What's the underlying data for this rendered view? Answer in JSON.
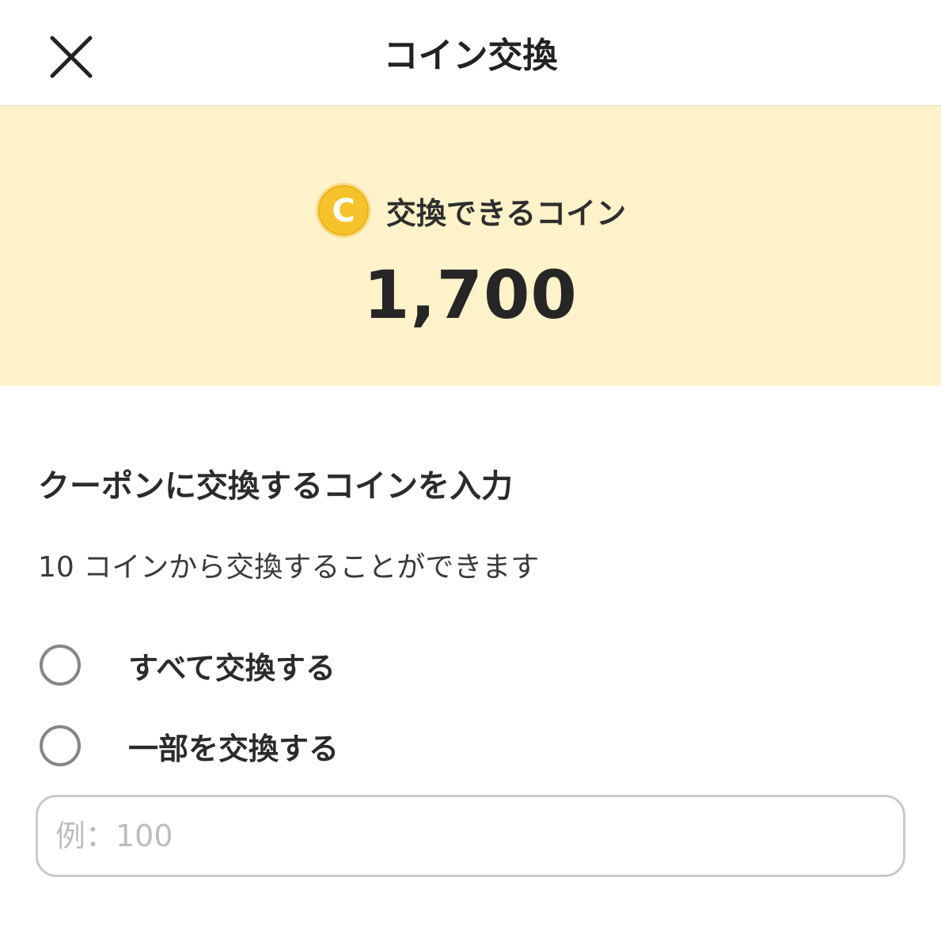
{
  "header": {
    "title": "コイン交換",
    "close_icon": "close-icon"
  },
  "balance": {
    "icon": "coin-icon",
    "icon_letter": "C",
    "label": "交換できるコイン",
    "value": "1,700"
  },
  "section": {
    "title": "クーポンに交換するコインを入力",
    "hint": "10 コインから交換することができます"
  },
  "options": {
    "all_label": "すべて交換する",
    "partial_label": "一部を交換する"
  },
  "input": {
    "value": "",
    "placeholder": "例：100"
  },
  "colors": {
    "banner_background": "#fdf2c9",
    "coin_gold": "#f4c32b",
    "radio_border": "#85858a",
    "input_border": "#c9c9cc"
  }
}
